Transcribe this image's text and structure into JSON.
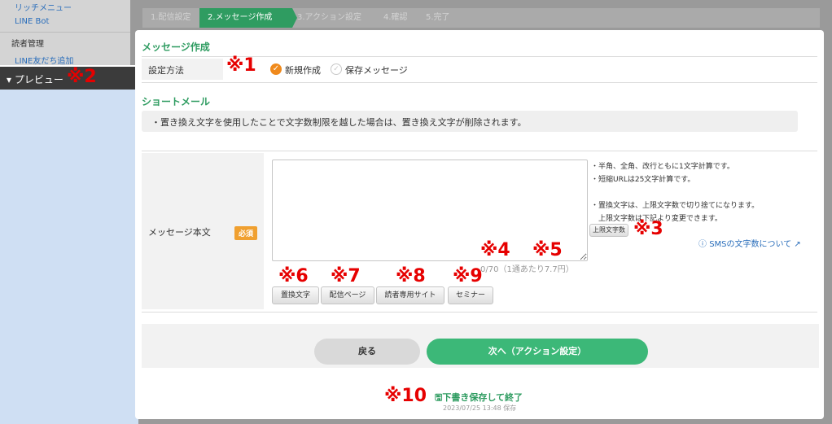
{
  "sidebar": {
    "items": [
      {
        "label": "リッチメニュー",
        "kind": "link"
      },
      {
        "label": "LINE Bot",
        "kind": "link"
      },
      {
        "label": "読者管理",
        "kind": "heading"
      },
      {
        "label": "LINE友だち追加",
        "kind": "link"
      }
    ],
    "preview_label": "▾ プレビュー",
    "preview_mark": "※2"
  },
  "steps": [
    {
      "label": "1.配信設定",
      "active": false
    },
    {
      "label": "2.メッセージ作成",
      "active": true
    },
    {
      "label": "3.アクション設定",
      "active": false
    },
    {
      "label": "4.確認",
      "active": false
    },
    {
      "label": "5.完了",
      "active": false
    }
  ],
  "message_section": {
    "title": "メッセージ作成",
    "setting_method_label": "設定方法",
    "mark": "※1",
    "options": [
      {
        "label": "新規作成",
        "selected": true
      },
      {
        "label": "保存メッセージ",
        "selected": false
      }
    ]
  },
  "sms_section": {
    "title": "ショートメール",
    "notice": "・置き換え文字を使用したことで文字数制限を越した場合は、置き換え文字が削除されます。",
    "body_label": "メッセージ本文",
    "required_badge": "必須",
    "textarea_value": "",
    "hints": [
      "・半角、全角、改行ともに1文字計算です。",
      "・短縮URLは25文字計算です。",
      "・置換文字は、上限文字数で切り捨てになります。",
      "　上限文字数は下記より変更できます。"
    ],
    "limit_button": "上限文字数",
    "mark3": "※3",
    "sms_link": "SMSの文字数について",
    "mark4": "※4",
    "mark5": "※5",
    "char_count": "0/70（1通あたり7.7円）",
    "insert_buttons": [
      {
        "label": "置換文字",
        "mark": "※6"
      },
      {
        "label": "配信ページ",
        "mark": "※7"
      },
      {
        "label": "読者専用サイト",
        "mark": "※8"
      },
      {
        "label": "セミナー",
        "mark": "※9"
      }
    ]
  },
  "footer": {
    "back_label": "戻る",
    "next_label": "次へ（アクション設定）",
    "mark10": "※10",
    "draft_label": "下書き保存して終了",
    "saved_time": "2023/07/25 13:48 保存"
  },
  "colors": {
    "accent_green": "#2f9c61",
    "next_button": "#3cb878",
    "annotation_red": "#e60000",
    "radio_orange": "#f08a1c",
    "link_blue": "#2a6ebb"
  }
}
